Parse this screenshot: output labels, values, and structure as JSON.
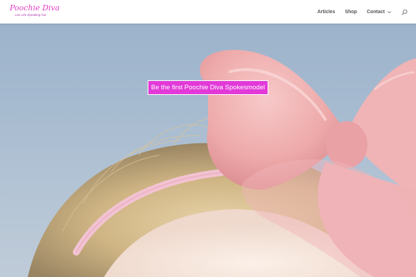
{
  "logo": {
    "title": "Poochie Diva",
    "tagline": "Live Life Speaking Out"
  },
  "nav": {
    "items": [
      {
        "label": "Articles"
      },
      {
        "label": "Shop"
      },
      {
        "label": "Contact",
        "has_dropdown": true
      }
    ],
    "search_icon": "search-icon"
  },
  "hero": {
    "cta_label": "Be the first Poochie Diva Spokesmodel",
    "cta_color": "#e239d8"
  },
  "colors": {
    "brand": "#e23fc4",
    "nav_text": "#555555",
    "header_bg": "#ffffff"
  }
}
